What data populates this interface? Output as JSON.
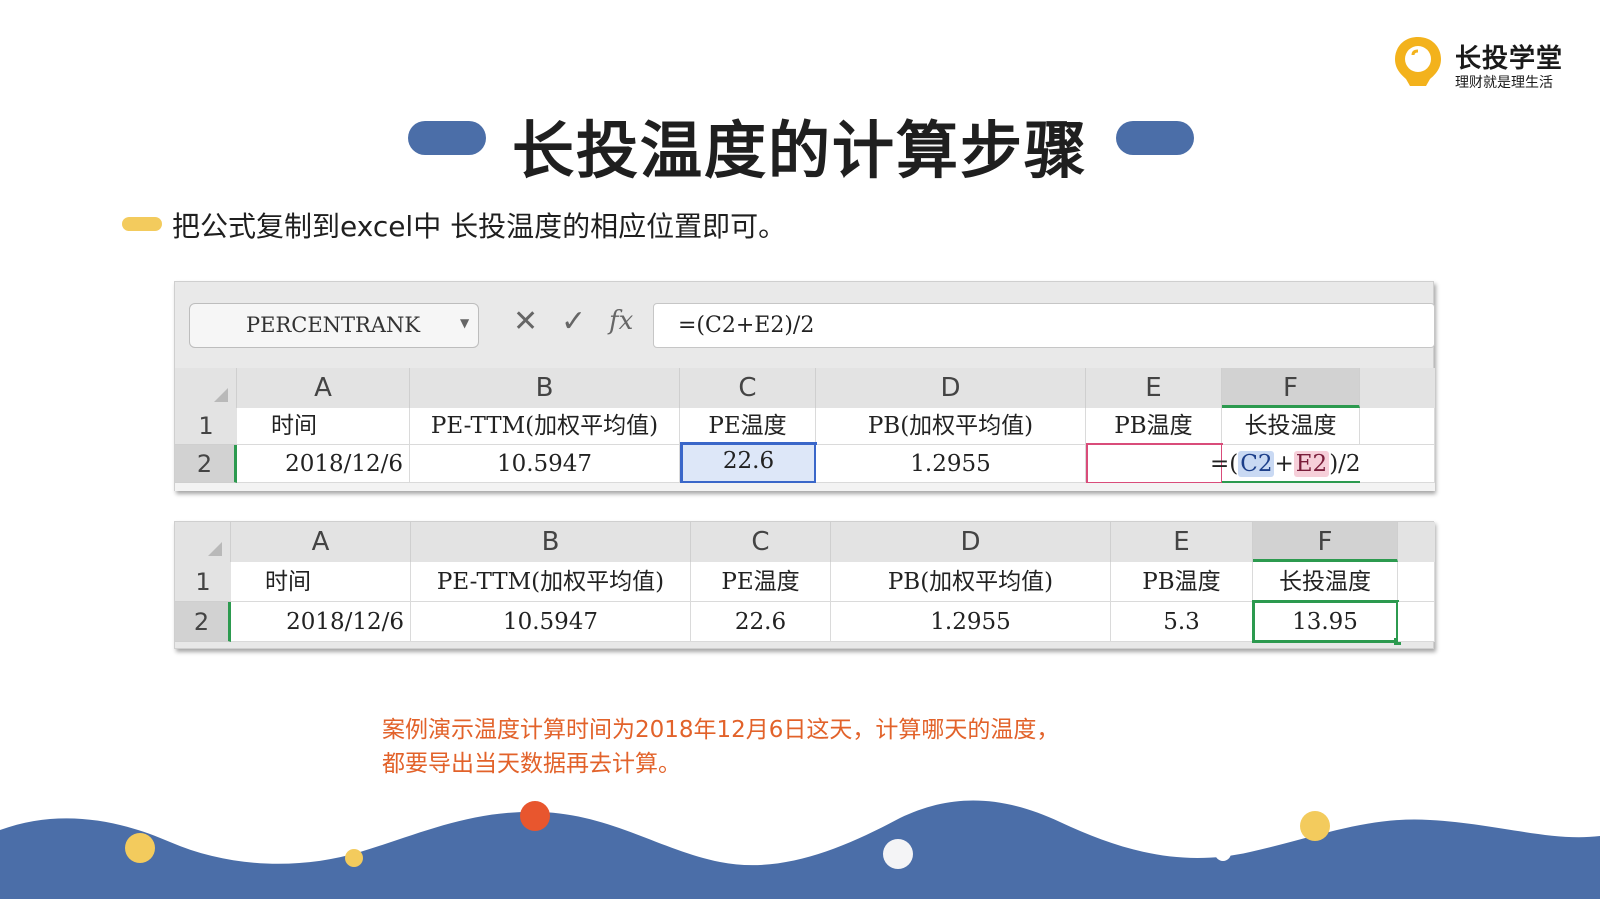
{
  "logo": {
    "brand": "长投学堂",
    "slogan": "理财就是理生活",
    "icon": "lightbulb-location-icon",
    "color": "#f3b21c"
  },
  "title": "长投温度的计算步骤",
  "bullet_text": "把公式复制到excel中 长投温度的相应位置即可。",
  "sheet1": {
    "name_box": "PERCENTRANK",
    "icons": {
      "cancel": "✕",
      "confirm": "✓",
      "fx": "fx"
    },
    "formula": "=(C2+E2)/2",
    "columns": [
      "A",
      "B",
      "C",
      "D",
      "E",
      "F"
    ],
    "row_numbers": [
      "1",
      "2"
    ],
    "header_row": [
      "时间",
      "PE-TTM(加权平均值)",
      "PE温度",
      "PB(加权平均值)",
      "PB温度",
      "长投温度"
    ],
    "data_row": [
      "2018/12/6",
      "10.5947",
      "22.6",
      "1.2955",
      ""
    ],
    "editing_formula": {
      "open": "=(",
      "ref1": "C2",
      "plus": "+",
      "ref2": "E2",
      "close": ")/2"
    }
  },
  "sheet2": {
    "columns": [
      "A",
      "B",
      "C",
      "D",
      "E",
      "F"
    ],
    "row_numbers": [
      "1",
      "2"
    ],
    "header_row": [
      "时间",
      "PE-TTM(加权平均值)",
      "PE温度",
      "PB(加权平均值)",
      "PB温度",
      "长投温度"
    ],
    "data_row": [
      "2018/12/6",
      "10.5947",
      "22.6",
      "1.2955",
      "5.3",
      "13.95"
    ]
  },
  "note": {
    "line1": "案例演示温度计算时间为2018年12月6日这天，计算哪天的温度，",
    "line2": "都要导出当天数据再去计算。"
  },
  "colors": {
    "accent_blue": "#4b6ea8",
    "accent_yellow": "#f3cb5d",
    "note_orange": "#e2622a",
    "selection_green": "#2c9a4f"
  }
}
